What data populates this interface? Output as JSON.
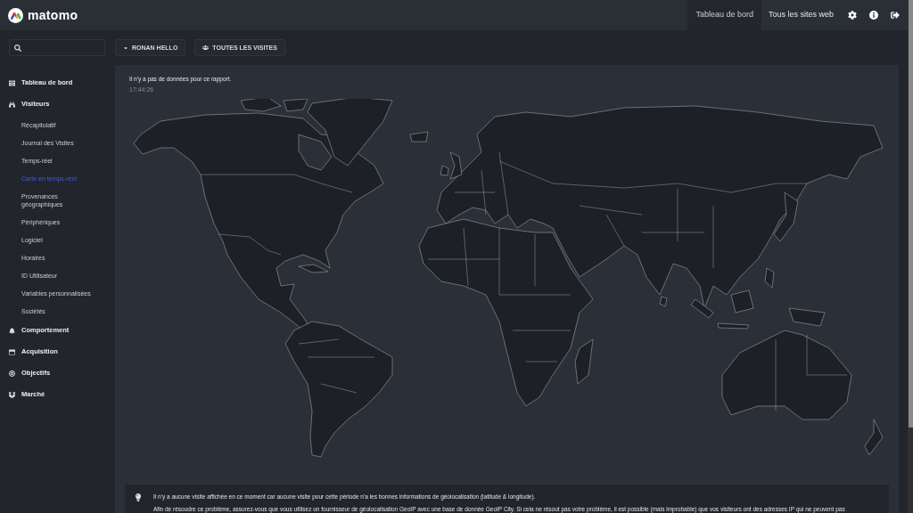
{
  "header": {
    "logo": "matomo",
    "nav": [
      {
        "label": "Tableau de bord",
        "selected": true
      },
      {
        "label": "Tous les sites web",
        "selected": false
      }
    ]
  },
  "toolbar": {
    "buttons": [
      {
        "kind": "dropdown",
        "label": "RONAN HELLO"
      },
      {
        "kind": "segment",
        "label": "TOUTES LES VISITES"
      }
    ]
  },
  "sidebar": {
    "sections": [
      {
        "label": "Tableau de bord",
        "selected": false
      },
      {
        "label": "Visiteurs",
        "selected": false,
        "children": [
          {
            "label": "Récapitulatif",
            "selected": false
          },
          {
            "label": "Journal des Visites",
            "selected": false
          },
          {
            "label": "Temps-réel",
            "selected": false
          },
          {
            "label": "Carte en temps-réel",
            "selected": true
          },
          {
            "label": "Provenances géographiques",
            "selected": false
          },
          {
            "label": "Périphériques",
            "selected": false
          },
          {
            "label": "Logiciel",
            "selected": false
          },
          {
            "label": "Horaires",
            "selected": false
          },
          {
            "label": "ID Utilisateur",
            "selected": false
          },
          {
            "label": "Variables personnalisées",
            "selected": false
          },
          {
            "label": "Sociétés",
            "selected": false
          }
        ]
      },
      {
        "label": "Comportement",
        "selected": false
      },
      {
        "label": "Acquisition",
        "selected": false
      },
      {
        "label": "Objectifs",
        "selected": false
      },
      {
        "label": "Marché",
        "selected": false
      }
    ]
  },
  "report": {
    "message": "Il n'y a pas de données pour ce rapport.",
    "time": "17:44:26"
  },
  "notice": {
    "paragraphs": [
      "Il n'y a aucune visite affichée en ce moment car aucune visite pour cette période n'a les bonnes informations de géolocalisation (latitude & longitude).",
      "Afin de résoudre ce problème, assurez-vous que vous utilisez un fournisseur de géolocalisation GeoIP avec une base de donnée GeoIP City. Si cela ne résout pas votre problème, il est possible (mais improbable) que vos visiteurs ont des adresses IP qui ne peuvent pas"
    ]
  }
}
